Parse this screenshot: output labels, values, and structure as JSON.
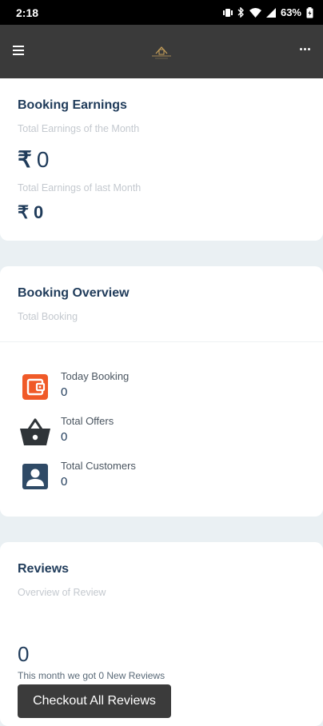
{
  "status_bar": {
    "time": "2:18",
    "battery": "63%"
  },
  "booking_earnings": {
    "title": "Booking Earnings",
    "this_month_label": "Total Earnings of the Month",
    "currency": "₹",
    "this_month_value": "0",
    "last_month_label": "Total Earnings of last Month",
    "last_month_value": "0"
  },
  "booking_overview": {
    "title": "Booking Overview",
    "subtitle": "Total Booking",
    "items": [
      {
        "label": "Today Booking",
        "value": "0",
        "icon": "wallet-icon",
        "color": "#f05a28"
      },
      {
        "label": "Total Offers",
        "value": "0",
        "icon": "basket-icon",
        "color": "#2f3438"
      },
      {
        "label": "Total Customers",
        "value": "0",
        "icon": "account-box-icon",
        "color": "#2f4a66"
      }
    ]
  },
  "reviews": {
    "title": "Reviews",
    "subtitle": "Overview of Review",
    "count": "0",
    "note": "This month we got 0 New Reviews",
    "button_label": "Checkout All Reviews"
  },
  "colors": {
    "app_bar": "#3a3a3a",
    "heading": "#1f3b5a",
    "background": "#eaf0f3"
  }
}
